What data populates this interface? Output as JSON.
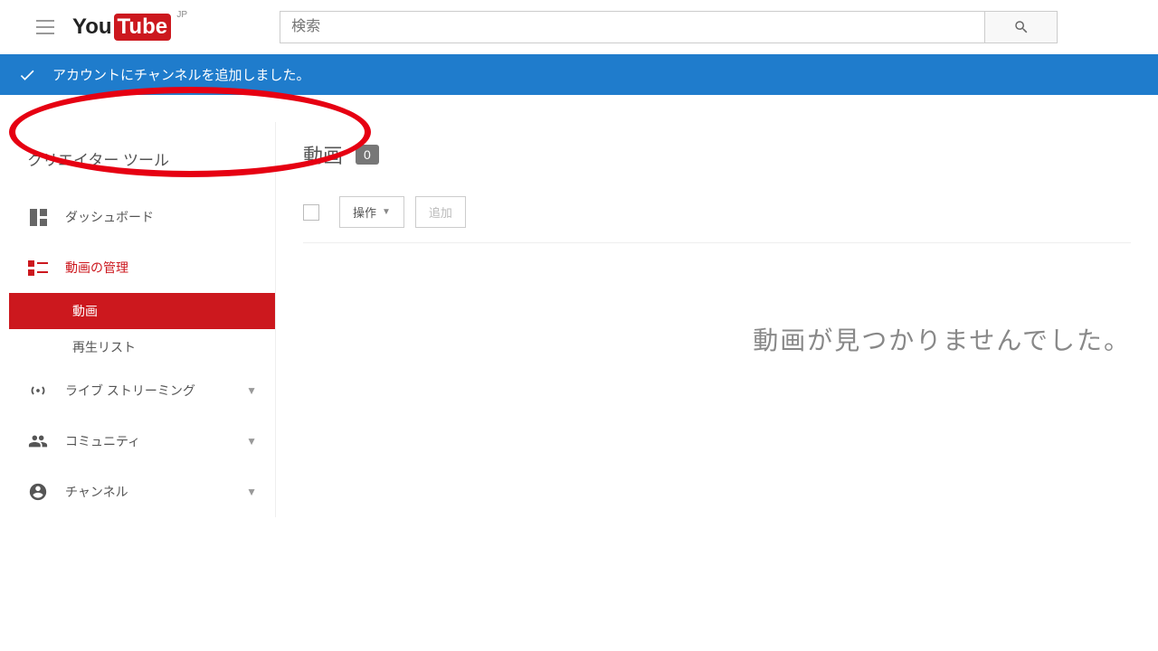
{
  "header": {
    "logo_you": "You",
    "logo_tube": "Tube",
    "country": "JP",
    "search_placeholder": "検索"
  },
  "banner": {
    "message": "アカウントにチャンネルを追加しました。"
  },
  "sidebar": {
    "title": "クリエイター ツール",
    "items": [
      {
        "label": "ダッシュボード"
      },
      {
        "label": "動画の管理"
      },
      {
        "label": "ライブ ストリーミング"
      },
      {
        "label": "コミュニティ"
      },
      {
        "label": "チャンネル"
      }
    ],
    "subitems": [
      {
        "label": "動画"
      },
      {
        "label": "再生リスト"
      }
    ]
  },
  "main": {
    "title": "動画",
    "count": "0",
    "actions_label": "操作",
    "add_label": "追加",
    "empty_message": "動画が見つかりませんでした。"
  }
}
